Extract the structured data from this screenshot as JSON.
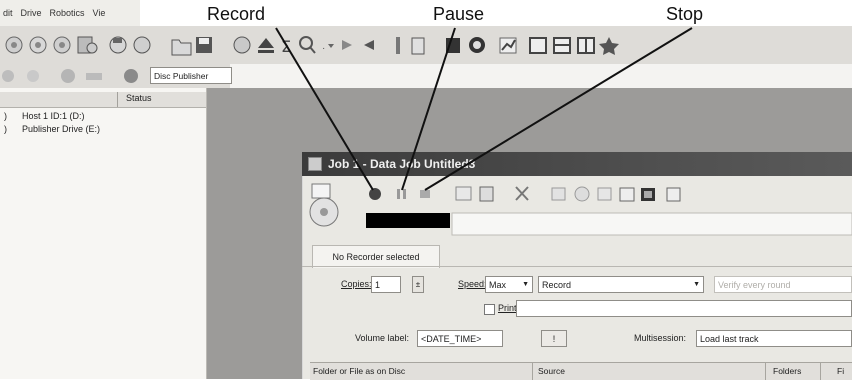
{
  "menu": {
    "items": [
      "dit",
      "Drive",
      "Robotics",
      "Vie"
    ]
  },
  "callouts": {
    "record": "Record",
    "pause": "Pause",
    "stop": "Stop"
  },
  "toolbar2": {
    "disc_publisher_label": "Disc Publisher"
  },
  "drives_panel": {
    "status_header": "Status",
    "items": [
      {
        "marker": ")",
        "label": "Host 1 ID:1 (D:)"
      },
      {
        "marker": ")",
        "label": "Publisher Drive (E:)"
      }
    ]
  },
  "job_window": {
    "title": "Job 1 - Data Job Untitled3",
    "recorder_tab": "No Recorder selected",
    "copies_label": "Copies:",
    "copies_value": "1",
    "speed_label": "Speed:",
    "speed_value": "Max",
    "mode_value": "Record",
    "verify_value": "Verify every round",
    "print_label": "Print",
    "volume_label": "Volume label:",
    "volume_value": "<DATE_TIME>",
    "volume_button": "!",
    "multisession_label": "Multisession:",
    "multisession_value": "Load last track",
    "columns": [
      "Folder or File as on Disc",
      "Source",
      "Folders",
      "Fi"
    ]
  },
  "colors": {
    "record": "#444444",
    "mdi_background": "#9c9b99",
    "titlebar": "#3b3b3b"
  }
}
